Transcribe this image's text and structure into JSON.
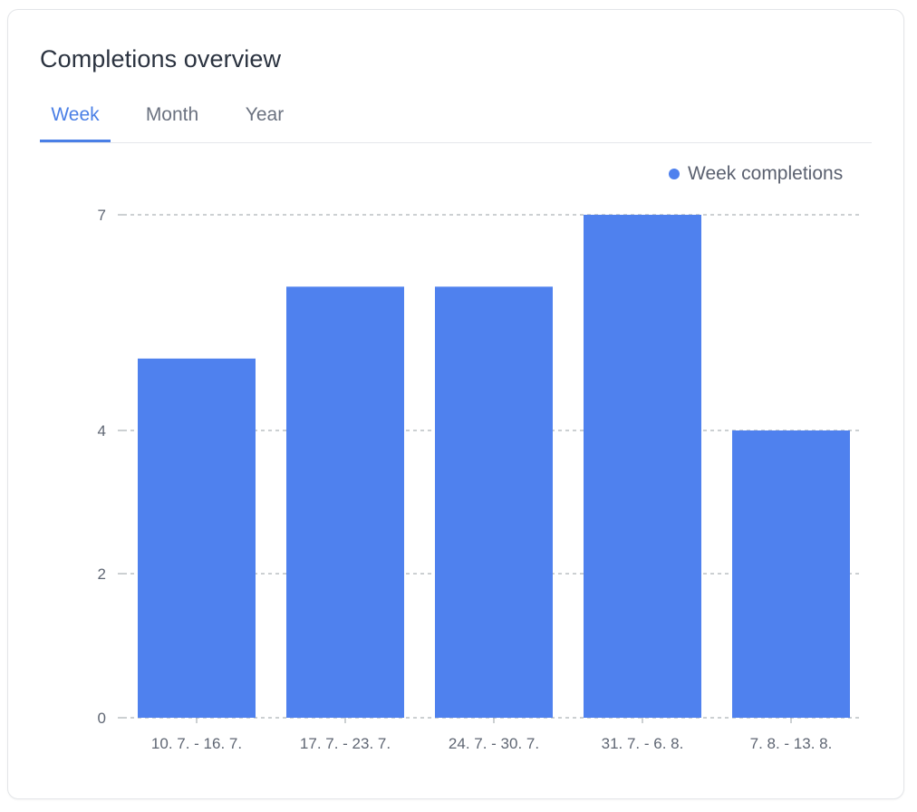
{
  "card": {
    "title": "Completions overview"
  },
  "tabs": [
    {
      "label": "Week",
      "active": true
    },
    {
      "label": "Month",
      "active": false
    },
    {
      "label": "Year",
      "active": false
    }
  ],
  "legend": {
    "label": "Week completions",
    "color": "#4f81ee"
  },
  "colors": {
    "accent": "#4a7fe6",
    "bar": "#4f81ee",
    "grid": "#9aa0a6",
    "text_muted": "#6b7280"
  },
  "chart_data": {
    "type": "bar",
    "title": "",
    "xlabel": "",
    "ylabel": "",
    "categories": [
      "10. 7. - 16. 7.",
      "17. 7. - 23. 7.",
      "24. 7. - 30. 7.",
      "31. 7. - 6. 8.",
      "7. 8. - 13. 8."
    ],
    "series": [
      {
        "name": "Week completions",
        "values": [
          5,
          6,
          6,
          7,
          4
        ]
      }
    ],
    "y_ticks": [
      0,
      2,
      4,
      7
    ],
    "ylim": [
      0,
      7
    ],
    "grid": true,
    "legend_position": "top-right"
  }
}
